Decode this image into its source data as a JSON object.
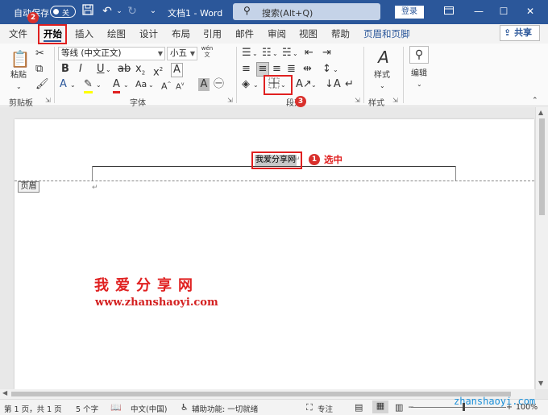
{
  "titlebar": {
    "autosave_label": "自动保存",
    "autosave_state": "关",
    "title": "文档1 - Word",
    "search_placeholder": "搜索(Alt+Q)",
    "login_label": "登录"
  },
  "tabs": [
    "文件",
    "开始",
    "插入",
    "绘图",
    "设计",
    "布局",
    "引用",
    "邮件",
    "审阅",
    "视图",
    "帮助",
    "页眉和页脚"
  ],
  "active_tab": "开始",
  "share_label": "共享",
  "ribbon": {
    "clipboard": {
      "paste_label": "粘贴",
      "group_label": "剪贴板"
    },
    "font": {
      "font_name": "等线 (中文正文)",
      "font_size": "小五",
      "wen": "wén",
      "group_label": "字体"
    },
    "paragraph": {
      "group_label": "段落"
    },
    "styles": {
      "styles_label": "样式",
      "group_label": "样式"
    },
    "editing": {
      "editing_label": "编辑"
    }
  },
  "document": {
    "header_text": "我爱分享网",
    "header_tag": "页眉",
    "watermark_title": "我爱分享网",
    "watermark_url": "www.zhanshaoyi.com"
  },
  "annotations": {
    "badge1": "1",
    "badge2": "2",
    "badge3": "3",
    "select_label": "选中"
  },
  "statusbar": {
    "page": "第 1 页，共 1 页",
    "words": "5 个字",
    "language": "中文(中国)",
    "accessibility": "辅助功能: 一切就绪",
    "focus": "专注",
    "zoom": "100%",
    "site_watermark": "zhanshaoyi.com"
  },
  "colors": {
    "titlebar": "#2b579a",
    "accent_red": "#e02020"
  }
}
